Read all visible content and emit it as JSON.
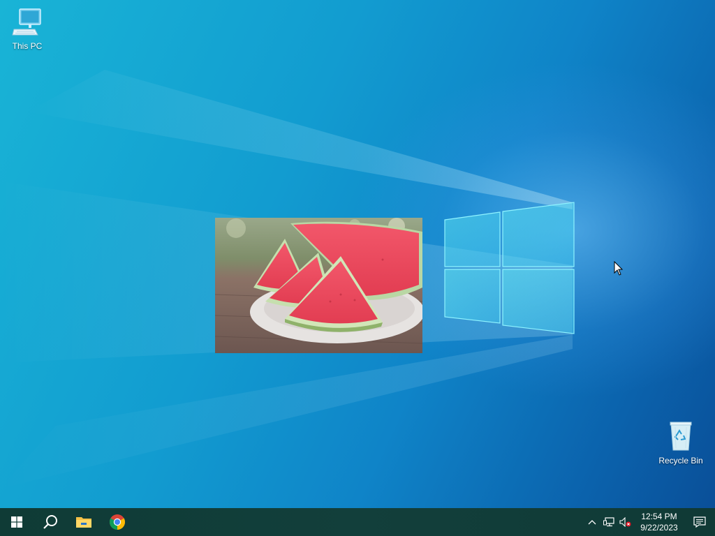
{
  "desktop": {
    "icons": [
      {
        "label": "This PC",
        "icon": "computer-icon"
      },
      {
        "label": "Recycle Bin",
        "icon": "recycle-bin-icon"
      }
    ],
    "wallpaper": {
      "colors": {
        "primary": "#129cd0",
        "dark": "#0a4f98",
        "light": "#19b4d6"
      }
    },
    "photo": {
      "subject": "watermelon-slices-image"
    }
  },
  "taskbar": {
    "color": "#103a36",
    "pinned": [
      {
        "name": "start-button",
        "icon": "windows-logo-icon"
      },
      {
        "name": "search-button",
        "icon": "search-icon"
      },
      {
        "name": "file-explorer-button",
        "icon": "folder-icon"
      },
      {
        "name": "chrome-button",
        "icon": "chrome-icon"
      }
    ],
    "tray": {
      "icons": [
        "chevron-up-icon",
        "network-icon",
        "volume-muted-icon"
      ],
      "time": "12:54 PM",
      "date": "9/22/2023",
      "notification_icon": "notification-icon"
    }
  }
}
